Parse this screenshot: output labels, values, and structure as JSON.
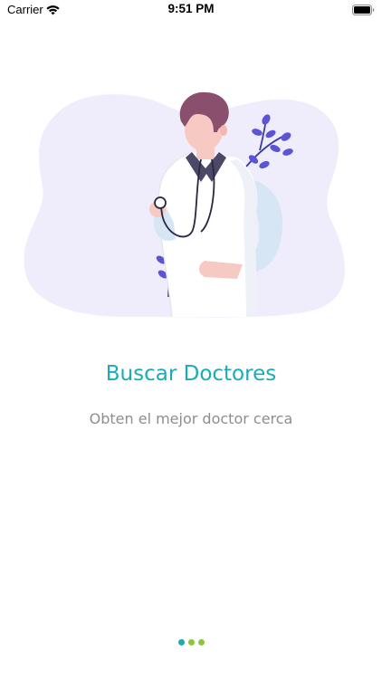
{
  "status_bar": {
    "carrier": "Carrier",
    "time": "9:51 PM",
    "wifi_icon": "wifi-icon",
    "battery_icon": "battery-icon"
  },
  "onboarding": {
    "illustration": "doctor-illustration",
    "title": "Buscar Doctores",
    "subtitle": "Obten el mejor doctor cerca"
  },
  "page_indicator": {
    "count": 3,
    "current": 1
  },
  "colors": {
    "accent": "#1aacb6",
    "subtitle_text": "#8e8e8e",
    "blob_background": "#efedfb",
    "dot_active": "#1aacb6",
    "dot_inactive": "#8cc63f",
    "leaf": "#5b55d6"
  }
}
